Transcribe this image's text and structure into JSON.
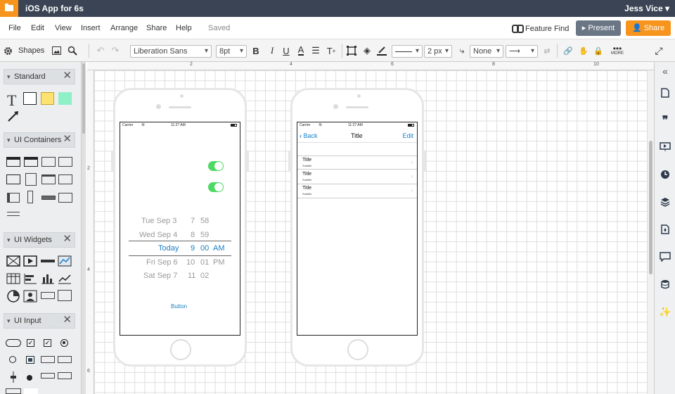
{
  "app": {
    "doc_title": "iOS App for 6s",
    "user": "Jess Vice"
  },
  "menu": {
    "items": [
      "File",
      "Edit",
      "View",
      "Insert",
      "Arrange",
      "Share",
      "Help"
    ],
    "status": "Saved",
    "feature_find": "Feature Find",
    "present": "Present",
    "share": "Share"
  },
  "toolbar": {
    "font": "Liberation Sans",
    "size": "8pt",
    "line_width": "2 px",
    "arrow_start": "None",
    "more": "MORE"
  },
  "sidebar": {
    "shapes_label": "Shapes",
    "sections": [
      "Standard",
      "UI Containers",
      "UI Widgets",
      "UI Input"
    ]
  },
  "ruler": {
    "top": [
      "2",
      "4",
      "6",
      "8",
      "10"
    ],
    "left": [
      "2",
      "4",
      "6"
    ]
  },
  "phone1": {
    "carrier": "Carrier",
    "time": "11:27 AM",
    "picker": [
      [
        "Tue Sep 3",
        "7",
        "58",
        ""
      ],
      [
        "Wed Sep 4",
        "8",
        "59",
        ""
      ],
      [
        "Today",
        "9",
        "00",
        "AM"
      ],
      [
        "Fri Sep 6",
        "10",
        "01",
        "PM"
      ],
      [
        "Sat Sep 7",
        "11",
        "02",
        ""
      ]
    ],
    "button": "Button"
  },
  "phone2": {
    "carrier": "Carrier",
    "time": "11:27 AM",
    "back": "Back",
    "title": "Title",
    "edit": "Edit",
    "cells": [
      {
        "title": "Title",
        "subtitle": "Subtitle"
      },
      {
        "title": "Title",
        "subtitle": "Subtitle"
      },
      {
        "title": "Title",
        "subtitle": "Subtitle"
      }
    ]
  },
  "colors": {
    "titlebar": "#3a4454",
    "accent_orange": "#f7941d",
    "ios_blue": "#1a7ec7",
    "toggle_green": "#4cd964"
  }
}
